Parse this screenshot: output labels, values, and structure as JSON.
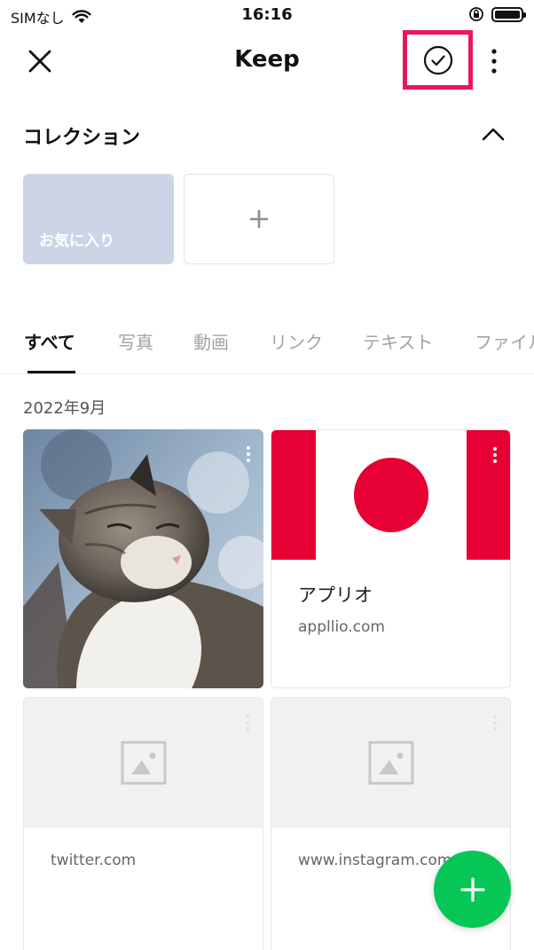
{
  "status_bar": {
    "carrier": "SIMなし",
    "time": "16:16"
  },
  "nav": {
    "title": "Keep"
  },
  "collection": {
    "title": "コレクション",
    "items": [
      {
        "label": "お気に入り",
        "color": "#cdd4e6"
      }
    ],
    "add_icon": "plus-icon"
  },
  "tabs": [
    {
      "label": "すべて",
      "active": true
    },
    {
      "label": "写真"
    },
    {
      "label": "動画"
    },
    {
      "label": "リンク"
    },
    {
      "label": "テキスト"
    },
    {
      "label": "ファイル"
    }
  ],
  "month_label": "2022年9月",
  "cards": [
    {
      "type": "photo",
      "image": "cat-photo"
    },
    {
      "type": "link",
      "title": "アプリオ",
      "url": "appllio.com",
      "image": "appllio-logo"
    },
    {
      "type": "link",
      "url": "twitter.com",
      "image": "image-placeholder-icon"
    },
    {
      "type": "link",
      "url": "www.instagram.com",
      "image": "image-placeholder-icon"
    }
  ],
  "colors": {
    "accent_green": "#06c755",
    "highlight_pink": "#e8175d",
    "appllio_red": "#e60033"
  }
}
